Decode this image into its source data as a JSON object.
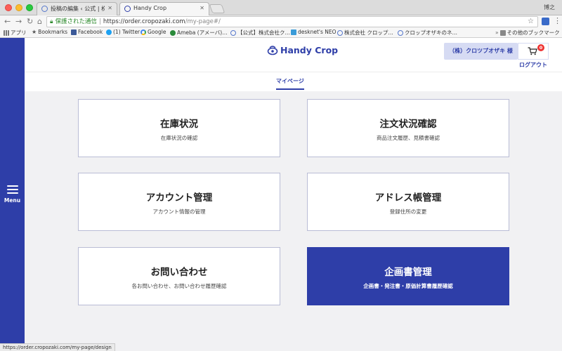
{
  "browser": {
    "tabs": [
      {
        "title": "投稿の編集 ‹ 公式 | 株式会社クロ…",
        "active": false
      },
      {
        "title": "Handy Crop",
        "active": true
      }
    ],
    "user_name": "博之",
    "address": {
      "secure_label": "保護された通信",
      "host": "https://order.cropozaki.com",
      "path": "/my-page#/"
    },
    "bookmarks": [
      {
        "label": "アプリ",
        "icon": "apps-grid-icon"
      },
      {
        "label": "Bookmarks",
        "icon": "star-icon"
      },
      {
        "label": "Facebook",
        "icon": "facebook-icon"
      },
      {
        "label": "(1) Twitter",
        "icon": "twitter-icon"
      },
      {
        "label": "Google",
        "icon": "google-icon"
      },
      {
        "label": "Ameba (アメーバ)…",
        "icon": "ameba-icon"
      },
      {
        "label": "【公式】株式会社ク…",
        "icon": "globe-icon"
      },
      {
        "label": "desknet's NEO",
        "icon": "desknets-icon"
      },
      {
        "label": "株式会社 クロップ…",
        "icon": "globe-icon"
      },
      {
        "label": "クロップオザキのネ…",
        "icon": "globe-icon"
      },
      {
        "label": "その他のブックマーク",
        "icon": "folder-icon"
      }
    ],
    "status_url": "https://order.cropozaki.com/my-page/design"
  },
  "sidebar": {
    "menu_label": "Menu"
  },
  "header": {
    "logo_text": "Handy Crop",
    "account_name": "（株）クロツプオザキ 様",
    "cart_count": "0",
    "logout_label": "ログアウト"
  },
  "subnav": {
    "current": "マイページ"
  },
  "cards": [
    {
      "title": "在庫状況",
      "subtitle": "在庫状況の確認"
    },
    {
      "title": "注文状況確認",
      "subtitle": "商品注文履歴、見積書確認"
    },
    {
      "title": "アカウント管理",
      "subtitle": "アカウント情報の管理"
    },
    {
      "title": "アドレス帳管理",
      "subtitle": "登録住所の変更"
    },
    {
      "title": "お問い合わせ",
      "subtitle": "各お問い合わせ、お問い合わせ履歴確認"
    },
    {
      "title": "企画書管理",
      "subtitle": "企画書・発注書・原価計算書履歴確認",
      "active": true
    }
  ],
  "colors": {
    "brand": "#2e3ea8",
    "account_bg": "#d6dbf3",
    "page_bg": "#f1f1f3",
    "card_border": "#b9bcd5",
    "badge": "#ee3333"
  }
}
